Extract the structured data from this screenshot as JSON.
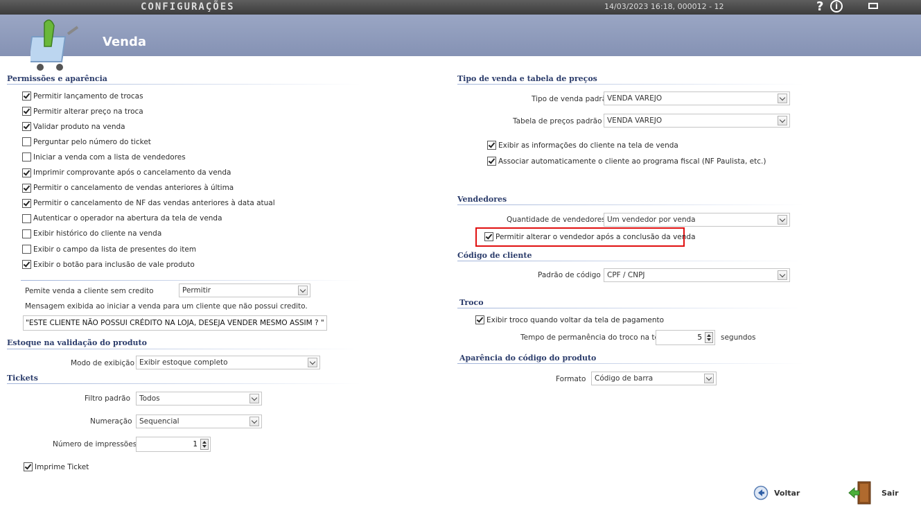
{
  "topbar": {
    "title": "CONFIGURAÇÕES",
    "datetime": "14/03/2023 16:18, 000012 - 12",
    "help": "?",
    "info": "i"
  },
  "header": {
    "title": "Venda"
  },
  "permissoes": {
    "title": "Permissões e aparência",
    "items": [
      {
        "label": "Permitir lançamento de trocas",
        "checked": true
      },
      {
        "label": "Permitir alterar preço na troca",
        "checked": true
      },
      {
        "label": "Validar produto na venda",
        "checked": true
      },
      {
        "label": "Perguntar pelo número do ticket",
        "checked": false
      },
      {
        "label": "Iniciar a venda com a lista de vendedores",
        "checked": false
      },
      {
        "label": "Imprimir comprovante após o cancelamento da venda",
        "checked": true
      },
      {
        "label": "Permitir o cancelamento de vendas anteriores à última",
        "checked": true
      },
      {
        "label": "Permitir o cancelamento de NF das vendas anteriores à data atual",
        "checked": true
      },
      {
        "label": "Autenticar o operador na abertura da tela de venda",
        "checked": false
      },
      {
        "label": "Exibir histórico do cliente na venda",
        "checked": false
      },
      {
        "label": "Exibir o campo da lista de presentes do item",
        "checked": false
      },
      {
        "label": "Exibir o botão para inclusão de vale produto",
        "checked": true
      }
    ],
    "credito_label": "Pemite venda a cliente sem credito",
    "credito_value": "Permitir",
    "mensagem_label": "Mensagem exibida ao iniciar a venda para um cliente que não possui credito.",
    "mensagem_value": "\"ESTE CLIENTE NÃO POSSUI CRÉDITO NA LOJA, DESEJA VENDER MESMO ASSIM ? \""
  },
  "estoque": {
    "title": "Estoque na validação do produto",
    "modo_label": "Modo de exibição",
    "modo_value": "Exibir estoque completo"
  },
  "tickets": {
    "title": "Tickets",
    "filtro_label": "Filtro padrão",
    "filtro_value": "Todos",
    "numeracao_label": "Numeração",
    "numeracao_value": "Sequencial",
    "impressoes_label": "Número de impressões",
    "impressoes_value": "1",
    "imprime_label": "Imprime Ticket",
    "imprime_checked": true
  },
  "tipo_venda": {
    "title": "Tipo de venda e tabela de preços",
    "tipo_label": "Tipo de venda padrão",
    "tipo_value": "VENDA VAREJO",
    "tabela_label": "Tabela de preços padrão",
    "tabela_value": "VENDA VAREJO",
    "exibir_info_label": "Exibir as informações do cliente na tela de venda",
    "exibir_info_checked": true,
    "associar_label": "Associar automaticamente o cliente ao programa fiscal (NF Paulista, etc.)",
    "associar_checked": true
  },
  "vendedores": {
    "title": "Vendedores",
    "quantidade_label": "Quantidade de vendedores",
    "quantidade_value": "Um vendedor por venda",
    "permitir_label": "Permitir alterar o vendedor após a conclusão da venda",
    "permitir_checked": true,
    "highlight_color": "#e01010"
  },
  "codigo_cliente": {
    "title": "Código de cliente",
    "padrao_label": "Padrão de código",
    "padrao_value": "CPF / CNPJ"
  },
  "troco": {
    "title": "Troco",
    "exibir_label": "Exibir troco quando voltar da tela de pagamento",
    "exibir_checked": true,
    "tempo_label": "Tempo de permanência do troco na tela",
    "tempo_value": "5",
    "tempo_unit": "segundos"
  },
  "aparencia_codigo": {
    "title": "Aparência do código do produto",
    "formato_label": "Formato",
    "formato_value": "Código de barra"
  },
  "footer": {
    "voltar_label": "Voltar",
    "sair_label": "Sair"
  }
}
